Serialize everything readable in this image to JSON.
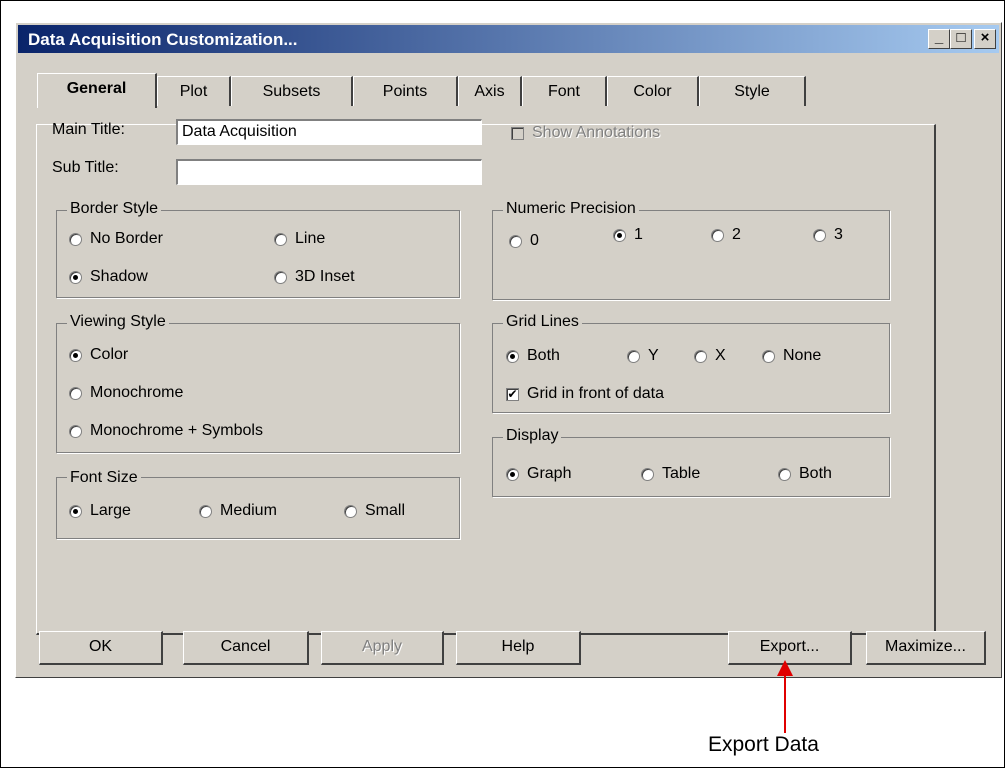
{
  "window": {
    "title": "Data Acquisition Customization..."
  },
  "title_buttons": {
    "minimize": "_",
    "maximize": "□",
    "close": "×"
  },
  "tabs": [
    "General",
    "Plot",
    "Subsets",
    "Points",
    "Axis",
    "Font",
    "Color",
    "Style"
  ],
  "general": {
    "main_title_label": "Main Title:",
    "main_title_value": "Data Acquisition",
    "sub_title_label": "Sub Title:",
    "sub_title_value": "",
    "show_annotations": {
      "label": "Show Annotations",
      "checked": false,
      "enabled": false
    },
    "border_style": {
      "legend": "Border Style",
      "options": [
        "No Border",
        "Line",
        "Shadow",
        "3D Inset"
      ],
      "selected": "Shadow"
    },
    "viewing_style": {
      "legend": "Viewing Style",
      "options": [
        "Color",
        "Monochrome",
        "Monochrome + Symbols"
      ],
      "selected": "Color"
    },
    "font_size": {
      "legend": "Font Size",
      "options": [
        "Large",
        "Medium",
        "Small"
      ],
      "selected": "Large"
    },
    "numeric_precision": {
      "legend": "Numeric Precision",
      "options": [
        "0",
        "1",
        "2",
        "3"
      ],
      "selected": "1"
    },
    "grid_lines": {
      "legend": "Grid Lines",
      "options": [
        "Both",
        "Y",
        "X",
        "None"
      ],
      "selected": "Both",
      "front_label": "Grid in front of data",
      "front_checked": true
    },
    "display": {
      "legend": "Display",
      "options": [
        "Graph",
        "Table",
        "Both"
      ],
      "selected": "Graph"
    }
  },
  "buttons": {
    "ok": "OK",
    "cancel": "Cancel",
    "apply": "Apply",
    "help": "Help",
    "export": "Export...",
    "maximize": "Maximize..."
  },
  "callout": {
    "text": "Export Data",
    "color": "#e00000"
  }
}
